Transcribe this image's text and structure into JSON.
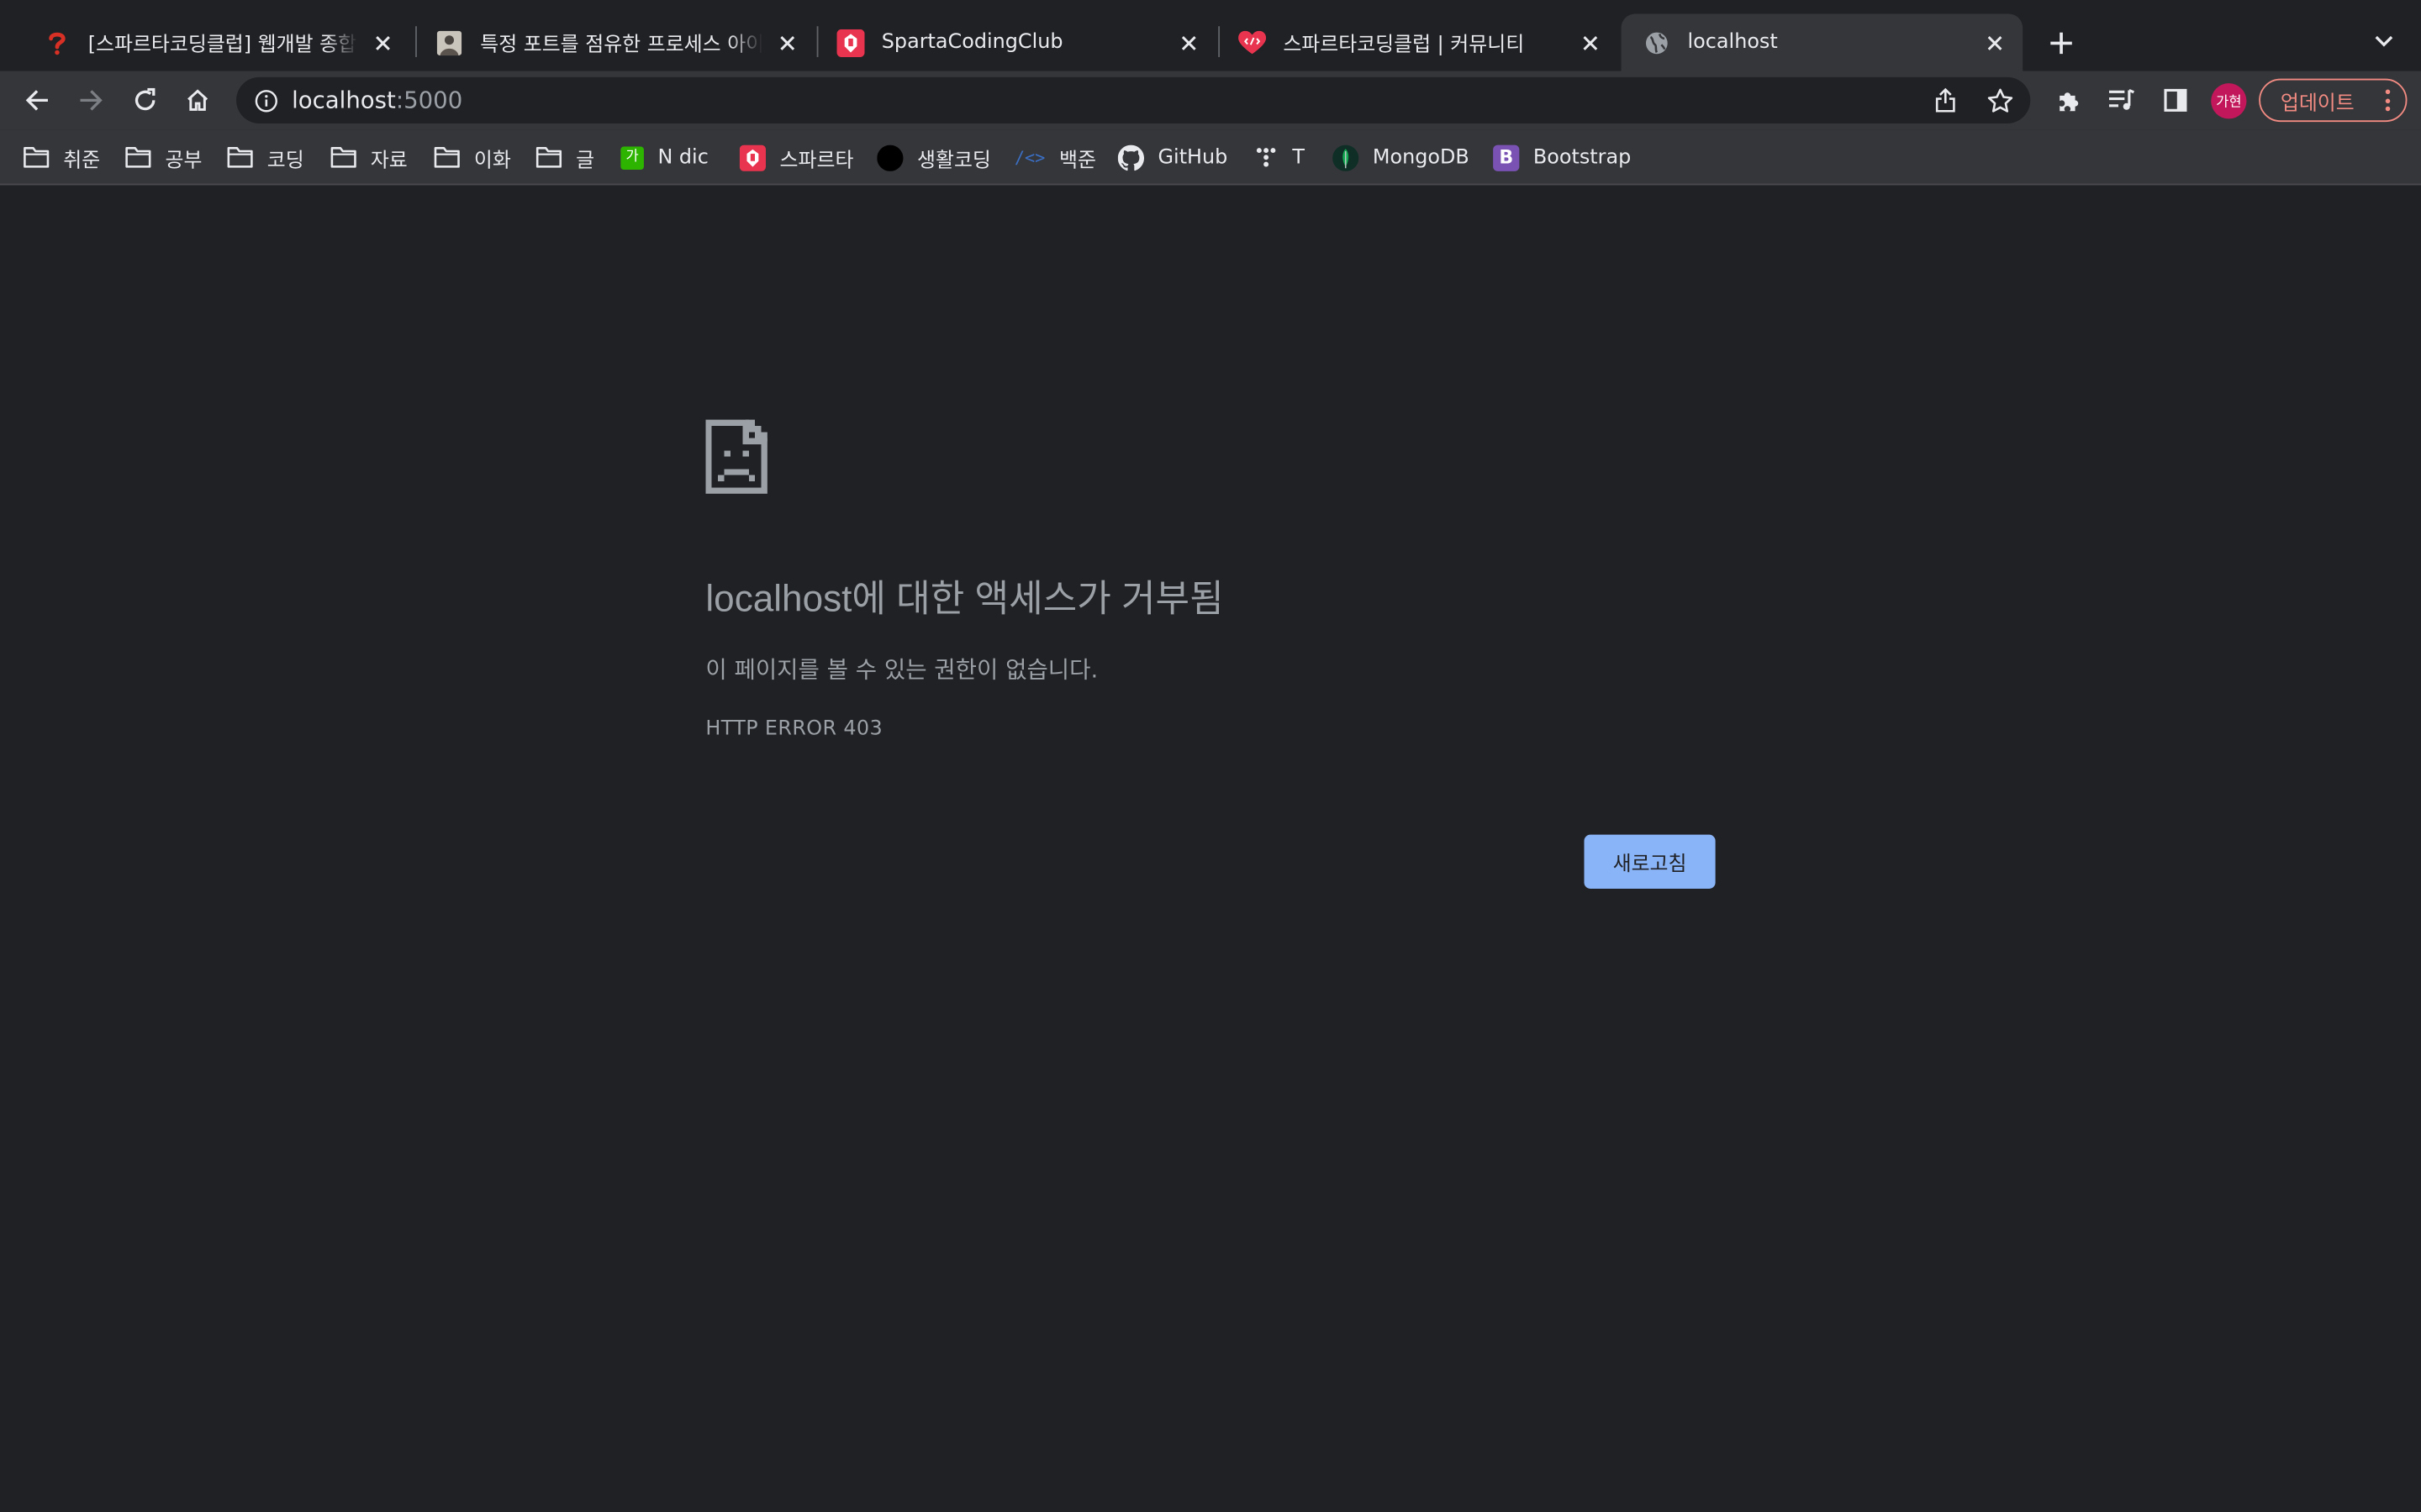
{
  "tabs": [
    {
      "title": "[스파르타코딩클럽] 웹개발 종합반 - ",
      "favicon": "question-mark-icon",
      "active": false
    },
    {
      "title": "특정 포트를 점유한 프로세스 아이디 ",
      "favicon": "profile-photo-icon",
      "active": false
    },
    {
      "title": "SpartaCodingClub",
      "favicon": "sparta-logo-icon",
      "active": false
    },
    {
      "title": "스파르타코딩클럽 | 커뮤니티",
      "favicon": "heart-code-icon",
      "active": false
    },
    {
      "title": "localhost",
      "favicon": "globe-icon",
      "active": true
    }
  ],
  "address_bar": {
    "host": "localhost",
    "port": ":5000"
  },
  "profile": {
    "avatar_text": "가현"
  },
  "update_button": {
    "label": "업데이트"
  },
  "bookmarks": [
    {
      "label": "취준",
      "icon": "folder-icon"
    },
    {
      "label": "공부",
      "icon": "folder-icon"
    },
    {
      "label": "코딩",
      "icon": "folder-icon"
    },
    {
      "label": "자료",
      "icon": "folder-icon"
    },
    {
      "label": "이화",
      "icon": "folder-icon"
    },
    {
      "label": "글",
      "icon": "folder-icon"
    },
    {
      "label": "N dic",
      "icon": "naver-dictionary-icon",
      "icon_text": "가"
    },
    {
      "label": "스파르타",
      "icon": "sparta-logo-icon"
    },
    {
      "label": "생활코딩",
      "icon": "black-circle-icon"
    },
    {
      "label": "백준",
      "icon": "code-brackets-icon",
      "icon_text": "/<>"
    },
    {
      "label": "GitHub",
      "icon": "github-icon"
    },
    {
      "label": "T",
      "icon": "tistory-dots-icon"
    },
    {
      "label": "MongoDB",
      "icon": "mongodb-leaf-icon"
    },
    {
      "label": "Bootstrap",
      "icon": "bootstrap-icon",
      "icon_text": "B"
    }
  ],
  "error_page": {
    "heading": "localhost에 대한 액세스가 거부됨",
    "description": "이 페이지를 볼 수 있는 권한이 없습니다.",
    "error_code": "HTTP ERROR 403",
    "reload_label": "새로고침"
  },
  "colors": {
    "page_background": "#202124",
    "toolbar_background": "#35363a",
    "accent_button": "#8ab4f8",
    "update_accent": "#f28b82",
    "avatar_background": "#c2185b"
  }
}
